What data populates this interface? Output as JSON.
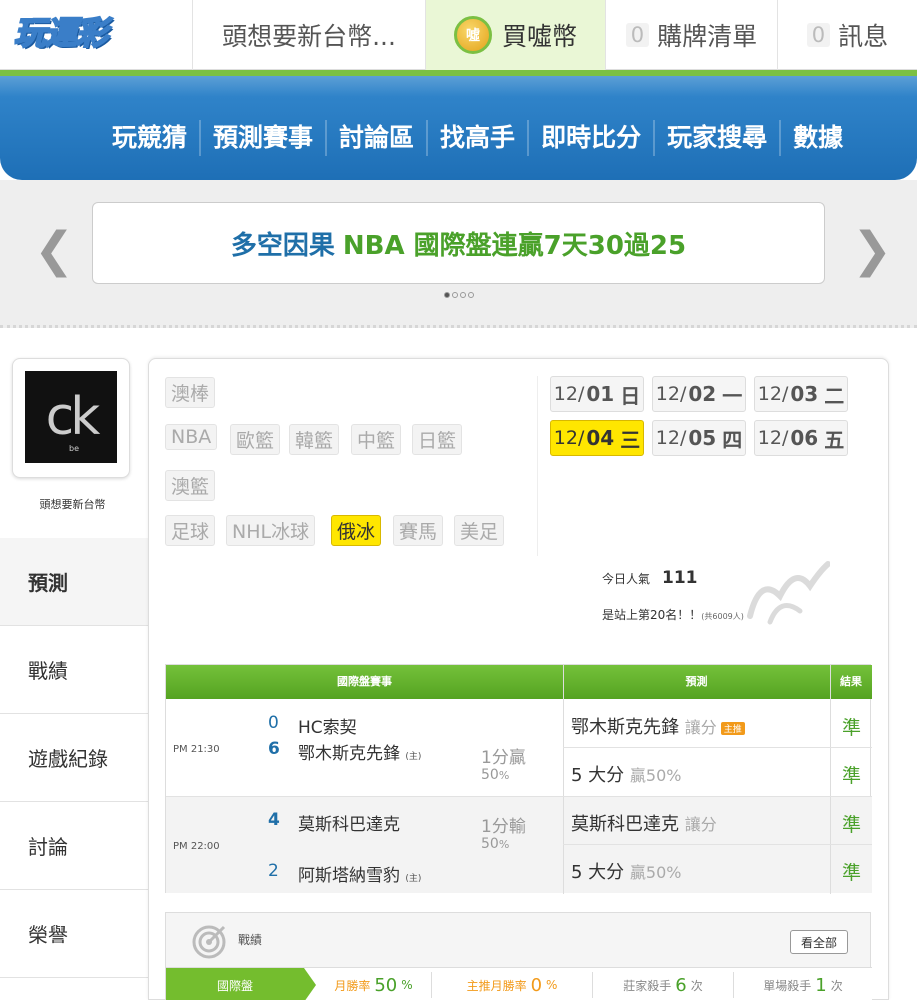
{
  "topbar": {
    "logo": "玩運彩",
    "tabs": [
      {
        "label": "頭想要新台幣..."
      },
      {
        "label": "買噓幣",
        "icon": "coin-icon",
        "coin_glyph": "噓"
      },
      {
        "count": "0",
        "label": "購牌清單"
      },
      {
        "count": "0",
        "label": "訊息"
      }
    ]
  },
  "nav": {
    "items": [
      "玩競猜",
      "預測賽事",
      "討論區",
      "找高手",
      "即時比分",
      "玩家搜尋",
      "數據"
    ]
  },
  "banner": {
    "text": "多空因果",
    "highlight": "NBA 國際盤連贏7天30過25",
    "page_dots": 4,
    "active_dot": 0
  },
  "profile": {
    "avatar_text": "ck",
    "avatar_sub": "be",
    "username": "頭想要新台幣"
  },
  "sidebar": {
    "items": [
      "預測",
      "戰績",
      "遊戲紀錄",
      "討論",
      "榮譽"
    ],
    "active": "預測"
  },
  "categories": {
    "row1": [
      "澳棒"
    ],
    "row2": [
      "NBA",
      "歐籃",
      "韓籃",
      "中籃",
      "日籃"
    ],
    "row3": [
      "澳籃"
    ],
    "row4": [
      "足球",
      "NHL冰球",
      "俄冰",
      "賽馬",
      "美足"
    ],
    "selected": "俄冰"
  },
  "dates": [
    {
      "md": "12/",
      "d": "01",
      "w": "日"
    },
    {
      "md": "12/",
      "d": "02",
      "w": "一"
    },
    {
      "md": "12/",
      "d": "03",
      "w": "二"
    },
    {
      "md": "12/",
      "d": "04",
      "w": "三"
    },
    {
      "md": "12/",
      "d": "05",
      "w": "四"
    },
    {
      "md": "12/",
      "d": "06",
      "w": "五"
    }
  ],
  "selected_date": "12/04 三",
  "popularity": {
    "label": "今日人氣",
    "value": "111",
    "rank": "是站上第20名！！",
    "total": "(共6009人)"
  },
  "table": {
    "headers": [
      "國際盤賽事",
      "預測",
      "結果"
    ],
    "games": [
      {
        "time": "PM 21:30",
        "team1": {
          "score": "0",
          "name": "HC索契",
          "home": ""
        },
        "team2": {
          "score": "6",
          "name": "鄂木斯克先鋒",
          "home": "(主)"
        },
        "line": "1分贏",
        "pct": "50",
        "pct_unit": "%",
        "preds": [
          {
            "pick": "鄂木斯克先鋒",
            "note": "讓分",
            "tag": "主推",
            "result": "準"
          },
          {
            "pick": "5 大分",
            "note": "贏50%",
            "tag": "",
            "result": "準"
          }
        ]
      },
      {
        "time": "PM 22:00",
        "team1": {
          "score": "4",
          "name": "莫斯科巴達克",
          "home": ""
        },
        "team2": {
          "score": "2",
          "name": "阿斯塔納雪豹",
          "home": "(主)"
        },
        "line": "1分輸",
        "pct": "50",
        "pct_unit": "%",
        "preds": [
          {
            "pick": "莫斯科巴達克",
            "note": "讓分",
            "tag": "",
            "result": "準"
          },
          {
            "pick": "5 大分",
            "note": "贏50%",
            "tag": "",
            "result": "準"
          }
        ]
      }
    ]
  },
  "stats": {
    "title": "戰績",
    "view_all": "看全部",
    "label": "國際盤",
    "items": [
      {
        "label": "月勝率",
        "value": "50",
        "unit": "%",
        "color": "#4aa12a"
      },
      {
        "label": "主推月勝率",
        "value": "0",
        "unit": "%",
        "color": "#f29a1a"
      },
      {
        "label": "莊家殺手",
        "value": "6",
        "unit": "次",
        "color": "#4aa12a"
      },
      {
        "label": "單場殺手",
        "value": "1",
        "unit": "次",
        "color": "#4aa12a"
      }
    ]
  }
}
